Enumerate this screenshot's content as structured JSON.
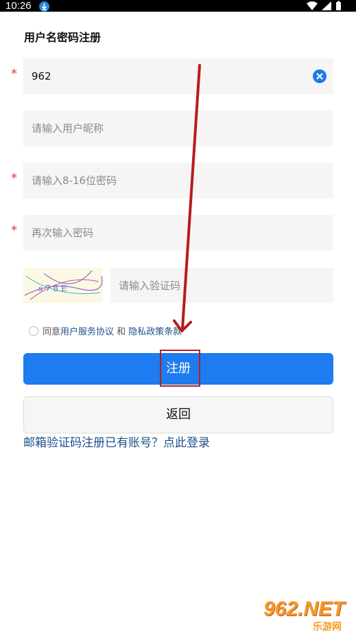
{
  "status_bar": {
    "time": "10:26"
  },
  "page": {
    "title": "用户名密码注册"
  },
  "form": {
    "required_mark": "*",
    "username": {
      "value": "962"
    },
    "nickname": {
      "placeholder": "请输入用户昵称"
    },
    "password": {
      "placeholder": "请输入8-16位密码"
    },
    "password_confirm": {
      "placeholder": "再次输入密码"
    },
    "captcha": {
      "image_text": "s 7 8 E",
      "placeholder": "请输入验证码"
    }
  },
  "agreement": {
    "prefix": "同意",
    "terms_link": "用户服务协议",
    "and": " 和 ",
    "privacy_link": "隐私政策条款"
  },
  "buttons": {
    "register": "注册",
    "back": "返回"
  },
  "links": {
    "email_register": "邮箱验证码注册",
    "login": "已有账号？点此登录"
  },
  "watermark": {
    "brand": "962.NET",
    "sub": "乐游网"
  },
  "colors": {
    "primary": "#1e7cf0",
    "link": "#1e4f8c",
    "required": "#e53935",
    "annotation": "#b71c1c"
  }
}
